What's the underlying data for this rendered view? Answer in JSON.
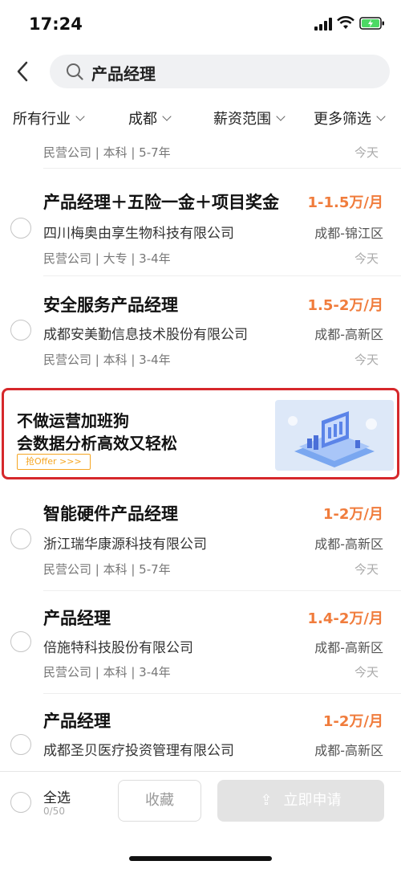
{
  "status": {
    "time": "17:24"
  },
  "search": {
    "query": "产品经理"
  },
  "filters": [
    {
      "label": "所有行业"
    },
    {
      "label": "成都"
    },
    {
      "label": "薪资范围"
    },
    {
      "label": "更多筛选"
    }
  ],
  "partial_top": {
    "meta": "民营公司 | 本科 | 5-7年",
    "date": "今天"
  },
  "jobs": [
    {
      "title": "产品经理＋五险一金＋项目奖金",
      "salary": "1-1.5万/月",
      "company": "四川梅奥由享生物科技有限公司",
      "location": "成都-锦江区",
      "meta": "民营公司 | 大专 | 3-4年",
      "date": "今天"
    },
    {
      "title": "安全服务产品经理",
      "salary": "1.5-2万/月",
      "company": "成都安美勤信息技术股份有限公司",
      "location": "成都-高新区",
      "meta": "民营公司 | 本科 | 3-4年",
      "date": "今天"
    },
    {
      "title": "智能硬件产品经理",
      "salary": "1-2万/月",
      "company": "浙江瑞华康源科技有限公司",
      "location": "成都-高新区",
      "meta": "民营公司 | 本科 | 5-7年",
      "date": "今天"
    },
    {
      "title": "产品经理",
      "salary": "1.4-2万/月",
      "company": "倍施特科技股份有限公司",
      "location": "成都-高新区",
      "meta": "民营公司 | 本科 | 3-4年",
      "date": "今天"
    },
    {
      "title": "产品经理",
      "salary": "1-2万/月",
      "company": "成都圣贝医疗投资管理有限公司",
      "location": "成都-高新区",
      "meta": "",
      "date": ""
    }
  ],
  "banner": {
    "line1": "不做运营加班狗",
    "line2": "会数据分析高效又轻松",
    "button": "抢Offer >>>"
  },
  "bottom": {
    "select_all": "全选",
    "count": "0/50",
    "favorite": "收藏",
    "apply": "立即申请"
  },
  "colors": {
    "salary": "#f07c3c",
    "banner_border": "#d6282b",
    "banner_button": "#f5a623"
  }
}
